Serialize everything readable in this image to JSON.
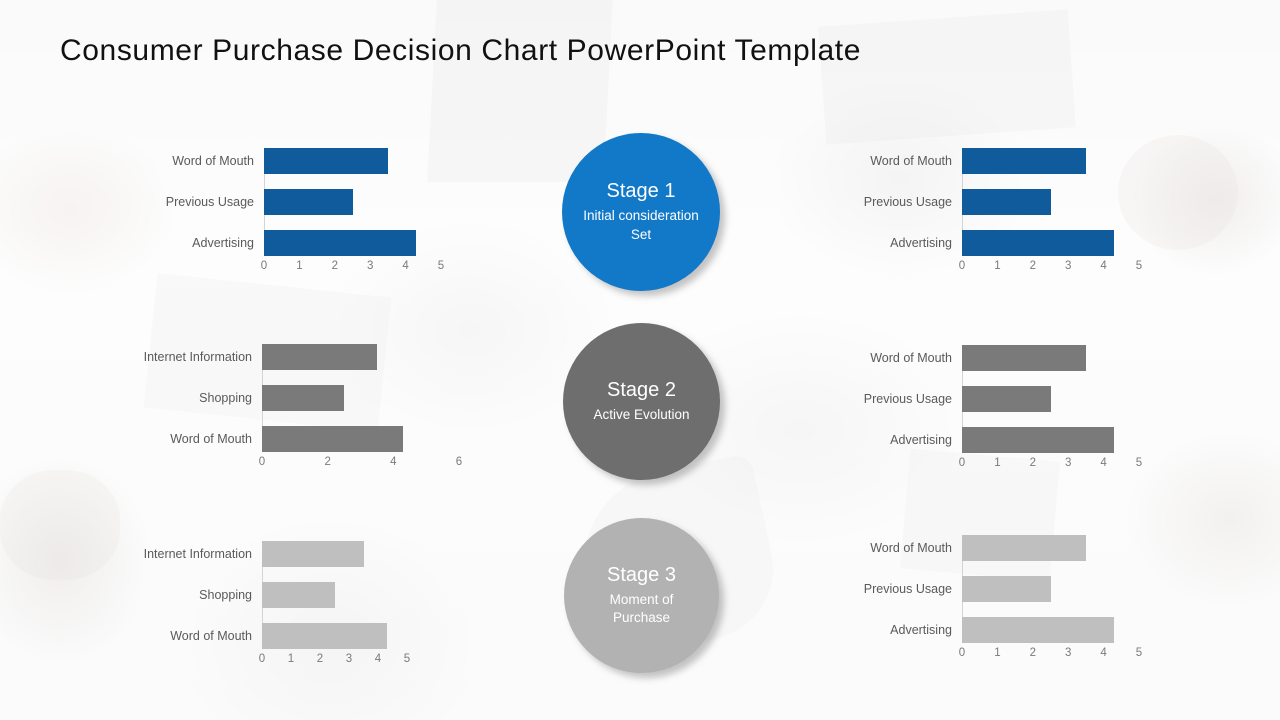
{
  "slide": {
    "title": "Consumer Purchase Decision Chart PowerPoint Template",
    "background_style": "faded-office-photo"
  },
  "colors": {
    "bar_blue": "#0f5b9c",
    "bar_gray_dark": "#7a7a7a",
    "bar_gray_light": "#bfbfbf",
    "circle_blue": "#1278c8",
    "circle_gray_dark": "#6e6e6e",
    "circle_gray_light": "#b2b2b2",
    "label_text": "#5a5a5a",
    "tick_text": "#7a7a7a",
    "title_text": "#111111"
  },
  "stages": [
    {
      "id": "stage-1",
      "title": "Stage 1",
      "subtitle": "Initial consideration Set",
      "color": "#1278c8"
    },
    {
      "id": "stage-2",
      "title": "Stage 2",
      "subtitle": "Active Evolution",
      "color": "#6e6e6e"
    },
    {
      "id": "stage-3",
      "title": "Stage 3",
      "subtitle": "Moment of Purchase",
      "color": "#b2b2b2"
    }
  ],
  "chart_data": [
    {
      "id": "chart-stage1-left",
      "position": "top-left",
      "type": "bar",
      "orientation": "horizontal",
      "title": "",
      "xlabel": "",
      "ylabel": "",
      "categories": [
        "Word of Mouth",
        "Previous Usage",
        "Advertising"
      ],
      "values": [
        3.5,
        2.5,
        4.3
      ],
      "ticks": [
        "0",
        "1",
        "2",
        "3",
        "4",
        "5"
      ],
      "xlim": [
        0,
        5
      ],
      "grid": false,
      "legend": "none",
      "color": "#0f5b9c"
    },
    {
      "id": "chart-stage1-right",
      "position": "top-right",
      "type": "bar",
      "orientation": "horizontal",
      "title": "",
      "xlabel": "",
      "ylabel": "",
      "categories": [
        "Word of Mouth",
        "Previous Usage",
        "Advertising"
      ],
      "values": [
        3.5,
        2.5,
        4.3
      ],
      "ticks": [
        "0",
        "1",
        "2",
        "3",
        "4",
        "5"
      ],
      "xlim": [
        0,
        5
      ],
      "grid": false,
      "legend": "none",
      "color": "#0f5b9c"
    },
    {
      "id": "chart-stage2-left",
      "position": "middle-left",
      "type": "bar",
      "orientation": "horizontal",
      "title": "",
      "xlabel": "",
      "ylabel": "",
      "categories": [
        "Internet Information",
        "Shopping",
        "Word of Mouth"
      ],
      "values": [
        3.5,
        2.5,
        4.3
      ],
      "ticks": [
        "0",
        "2",
        "4",
        "6"
      ],
      "xlim": [
        0,
        6
      ],
      "grid": false,
      "legend": "none",
      "color": "#7a7a7a"
    },
    {
      "id": "chart-stage2-right",
      "position": "middle-right",
      "type": "bar",
      "orientation": "horizontal",
      "title": "",
      "xlabel": "",
      "ylabel": "",
      "categories": [
        "Word of Mouth",
        "Previous Usage",
        "Advertising"
      ],
      "values": [
        3.5,
        2.5,
        4.3
      ],
      "ticks": [
        "0",
        "1",
        "2",
        "3",
        "4",
        "5"
      ],
      "xlim": [
        0,
        5
      ],
      "grid": false,
      "legend": "none",
      "color": "#7a7a7a"
    },
    {
      "id": "chart-stage3-left",
      "position": "bottom-left",
      "type": "bar",
      "orientation": "horizontal",
      "title": "",
      "xlabel": "",
      "ylabel": "",
      "categories": [
        "Internet Information",
        "Shopping",
        "Word of Mouth"
      ],
      "values": [
        3.5,
        2.5,
        4.3
      ],
      "ticks": [
        "0",
        "1",
        "2",
        "3",
        "4",
        "5"
      ],
      "xlim": [
        0,
        5
      ],
      "grid": false,
      "legend": "none",
      "color": "#bfbfbf"
    },
    {
      "id": "chart-stage3-right",
      "position": "bottom-right",
      "type": "bar",
      "orientation": "horizontal",
      "title": "",
      "xlabel": "",
      "ylabel": "",
      "categories": [
        "Word of Mouth",
        "Previous Usage",
        "Advertising"
      ],
      "values": [
        3.5,
        2.5,
        4.3
      ],
      "ticks": [
        "0",
        "1",
        "2",
        "3",
        "4",
        "5"
      ],
      "xlim": [
        0,
        5
      ],
      "grid": false,
      "legend": "none",
      "color": "#bfbfbf"
    }
  ]
}
